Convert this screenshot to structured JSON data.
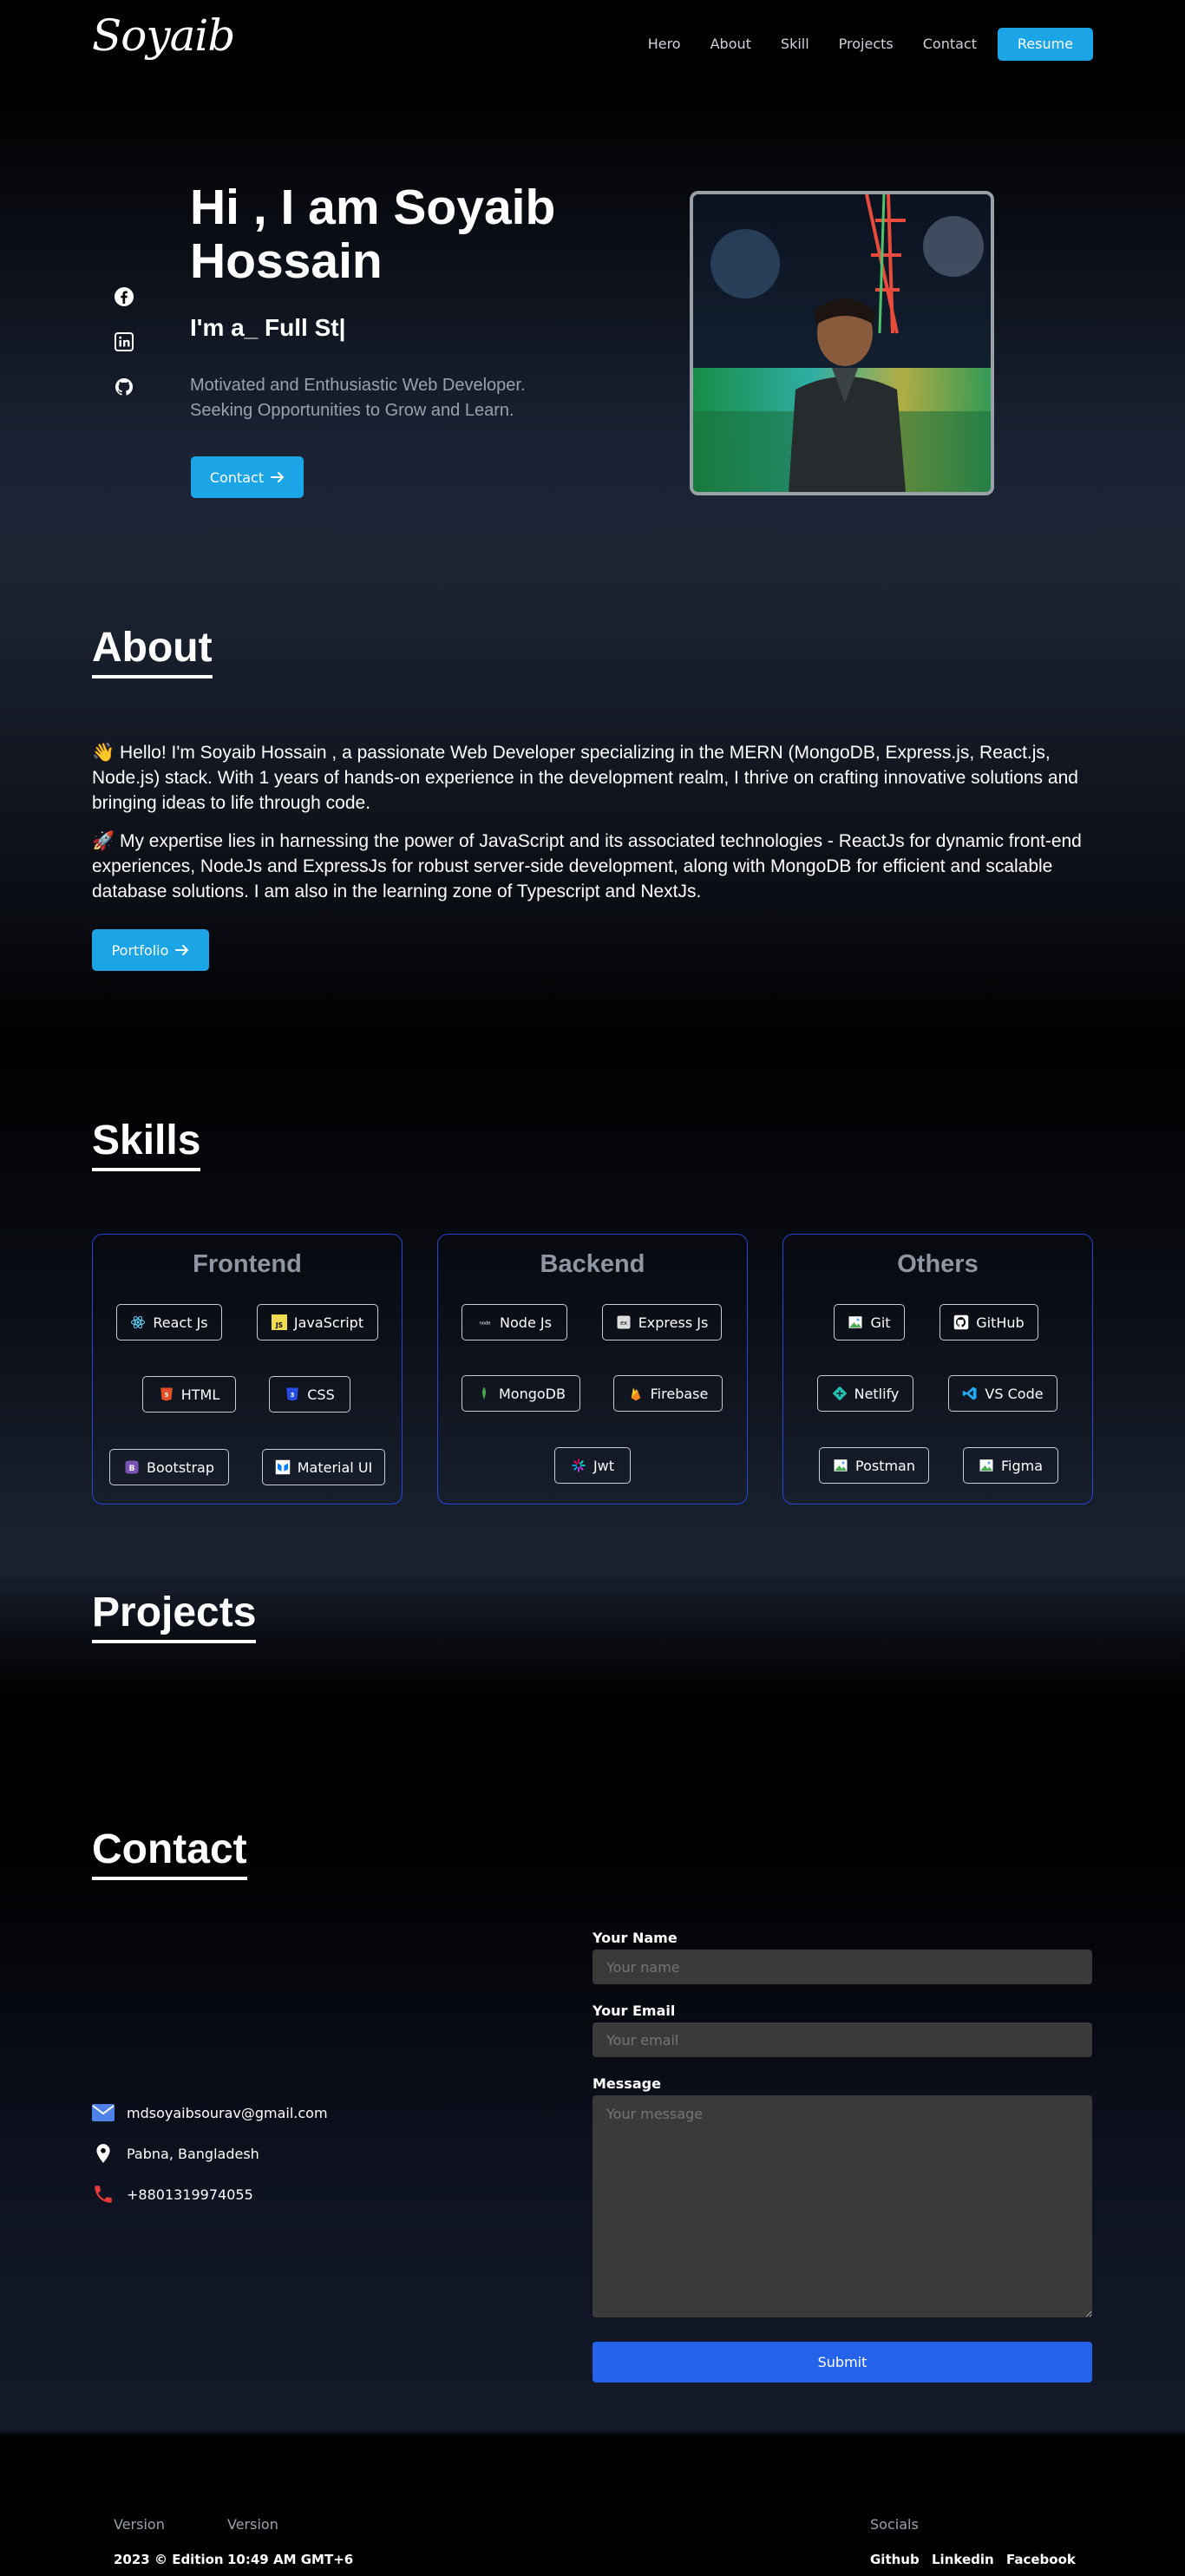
{
  "nav": {
    "logo": "Soyaib",
    "links": [
      "Hero",
      "About",
      "Skill",
      "Projects",
      "Contact"
    ],
    "resume": "Resume"
  },
  "hero": {
    "title": "Hi , I am Soyaib Hossain",
    "typed": "I'm a_ Full St|",
    "description": "Motivated and Enthusiastic Web Developer. Seeking Opportunities to Grow and Learn.",
    "contact_button": "Contact",
    "socials": [
      "facebook-icon",
      "linkedin-icon",
      "github-icon"
    ]
  },
  "about": {
    "title": "About",
    "p1": "👋 Hello! I'm Soyaib Hossain , a passionate Web Developer specializing in the MERN (MongoDB, Express.js, React.js, Node.js) stack. With 1 years of hands-on experience in the development realm, I thrive on crafting innovative solutions and bringing ideas to life through code.",
    "p2": "🚀 My expertise lies in harnessing the power of JavaScript and its associated technologies - ReactJs for dynamic front-end experiences, NodeJs and ExpressJs for robust server-side development, along with MongoDB for efficient and scalable database solutions. I am also in the learning zone of Typescript and NextJs.",
    "portfolio_button": "Portfolio"
  },
  "skills": {
    "title": "Skills",
    "frontend": {
      "title": "Frontend",
      "items": [
        "React Js",
        "JavaScript",
        "HTML",
        "CSS",
        "Bootstrap",
        "Material UI"
      ]
    },
    "backend": {
      "title": "Backend",
      "items": [
        "Node Js",
        "Express Js",
        "MongoDB",
        "Firebase",
        "Jwt"
      ]
    },
    "others": {
      "title": "Others",
      "items": [
        "Git",
        "GitHub",
        "Netlify",
        "VS Code",
        "Postman",
        "Figma"
      ]
    }
  },
  "projects": {
    "title": "Projects"
  },
  "contact": {
    "title": "Contact",
    "email": "mdsoyaibsourav@gmail.com",
    "location": "Pabna, Bangladesh",
    "phone": "+8801319974055",
    "name_label": "Your Name",
    "name_placeholder": "Your name",
    "email_label": "Your Email",
    "email_placeholder": "Your email",
    "message_label": "Message",
    "message_placeholder": "Your message",
    "submit": "Submit"
  },
  "footer": {
    "version_label_1": "Version",
    "version_value_1": "2023 © Edition",
    "version_label_2": "Version",
    "version_value_2": "10:49 AM GMT+6",
    "socials_label": "Socials",
    "socials": [
      "Github",
      "Linkedin",
      "Facebook"
    ]
  },
  "colors": {
    "accent": "#1ba4e6",
    "card_border": "#2546d6",
    "submit": "#2563eb"
  }
}
